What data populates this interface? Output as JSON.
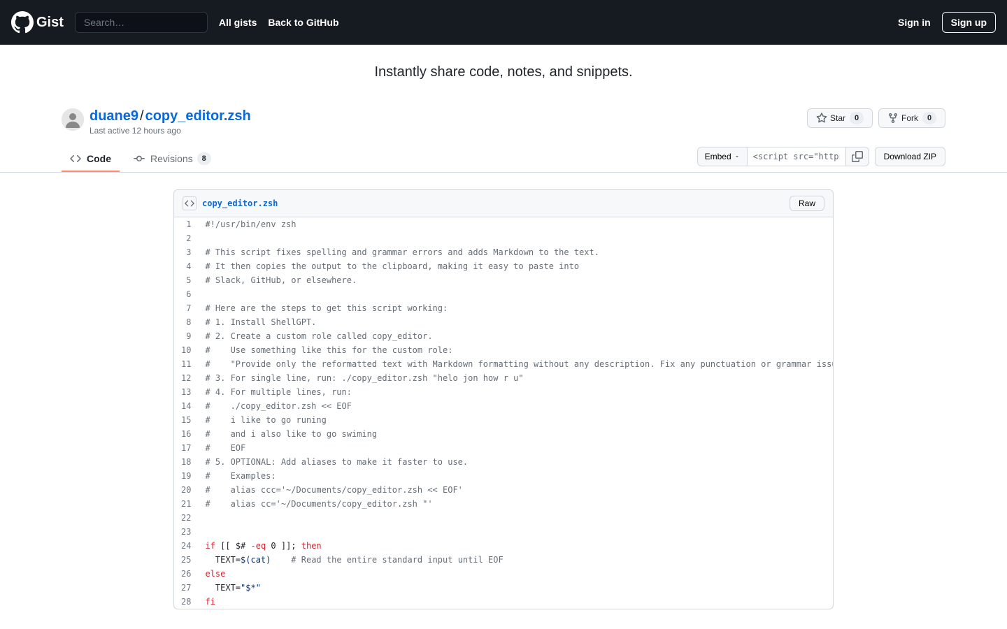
{
  "header": {
    "logo_text": "Gist",
    "search_placeholder": "Search…",
    "nav": {
      "all_gists": "All gists",
      "back": "Back to GitHub"
    },
    "sign_in": "Sign in",
    "sign_up": "Sign up"
  },
  "tagline": "Instantly share code, notes, and snippets.",
  "gist": {
    "author": "duane9",
    "separator": "/",
    "filename": "copy_editor.zsh",
    "last_active": "Last active 12 hours ago"
  },
  "actions": {
    "star_label": "Star",
    "star_count": "0",
    "fork_label": "Fork",
    "fork_count": "0"
  },
  "tabs": {
    "code": "Code",
    "revisions": "Revisions",
    "revisions_count": "8"
  },
  "toolbar": {
    "embed": "Embed",
    "embed_value": "<script src=\"https:/",
    "download": "Download ZIP"
  },
  "file": {
    "name": "copy_editor.zsh",
    "raw": "Raw"
  },
  "code_lines": [
    {
      "n": "1",
      "t": "comment",
      "c": "#!/usr/bin/env zsh"
    },
    {
      "n": "2",
      "t": "blank",
      "c": ""
    },
    {
      "n": "3",
      "t": "comment",
      "c": "# This script fixes spelling and grammar errors and adds Markdown to the text."
    },
    {
      "n": "4",
      "t": "comment",
      "c": "# It then copies the output to the clipboard, making it easy to paste into"
    },
    {
      "n": "5",
      "t": "comment",
      "c": "# Slack, GitHub, or elsewhere."
    },
    {
      "n": "6",
      "t": "blank",
      "c": ""
    },
    {
      "n": "7",
      "t": "comment",
      "c": "# Here are the steps to get this script working:"
    },
    {
      "n": "8",
      "t": "comment",
      "c": "# 1. Install ShellGPT."
    },
    {
      "n": "9",
      "t": "comment",
      "c": "# 2. Create a custom role called copy_editor."
    },
    {
      "n": "10",
      "t": "comment",
      "c": "#    Use something like this for the custom role:"
    },
    {
      "n": "11",
      "t": "comment",
      "c": "#    \"Provide only the reformatted text with Markdown formatting without any description. Fix any punctuation or grammar issues."
    },
    {
      "n": "12",
      "t": "comment",
      "c": "# 3. For single line, run: ./copy_editor.zsh \"helo jon how r u\""
    },
    {
      "n": "13",
      "t": "comment",
      "c": "# 4. For multiple lines, run:"
    },
    {
      "n": "14",
      "t": "comment",
      "c": "#    ./copy_editor.zsh << EOF"
    },
    {
      "n": "15",
      "t": "comment",
      "c": "#    i like to go runing"
    },
    {
      "n": "16",
      "t": "comment",
      "c": "#    and i also like to go swiming"
    },
    {
      "n": "17",
      "t": "comment",
      "c": "#    EOF"
    },
    {
      "n": "18",
      "t": "comment",
      "c": "# 5. OPTIONAL: Add aliases to make it faster to use."
    },
    {
      "n": "19",
      "t": "comment",
      "c": "#    Examples:"
    },
    {
      "n": "20",
      "t": "comment",
      "c": "#    alias ccc='~/Documents/copy_editor.zsh << EOF'"
    },
    {
      "n": "21",
      "t": "comment",
      "c": "#    alias cc='~/Documents/copy_editor.zsh \"'"
    },
    {
      "n": "22",
      "t": "blank",
      "c": ""
    },
    {
      "n": "23",
      "t": "blank",
      "c": ""
    },
    {
      "n": "24",
      "t": "if",
      "c": ""
    },
    {
      "n": "25",
      "t": "text_cat",
      "c": ""
    },
    {
      "n": "26",
      "t": "else",
      "c": ""
    },
    {
      "n": "27",
      "t": "text_args",
      "c": ""
    },
    {
      "n": "28",
      "t": "fi",
      "c": ""
    }
  ],
  "tokens": {
    "if": "if",
    "brackets_open": " [[ ",
    "dollar_hash": "$#",
    "eq": " -eq ",
    "zero_close": "0 ]]",
    "semi_then": "; ",
    "then": "then",
    "text_eq": "  TEXT=",
    "cat": "$(cat)",
    "cat_comment_pad": "    ",
    "cat_comment": "# Read the entire standard input until EOF",
    "else": "else",
    "text_args_pre": "  TEXT=",
    "text_args_str": "\"$*\"",
    "fi": "fi"
  }
}
